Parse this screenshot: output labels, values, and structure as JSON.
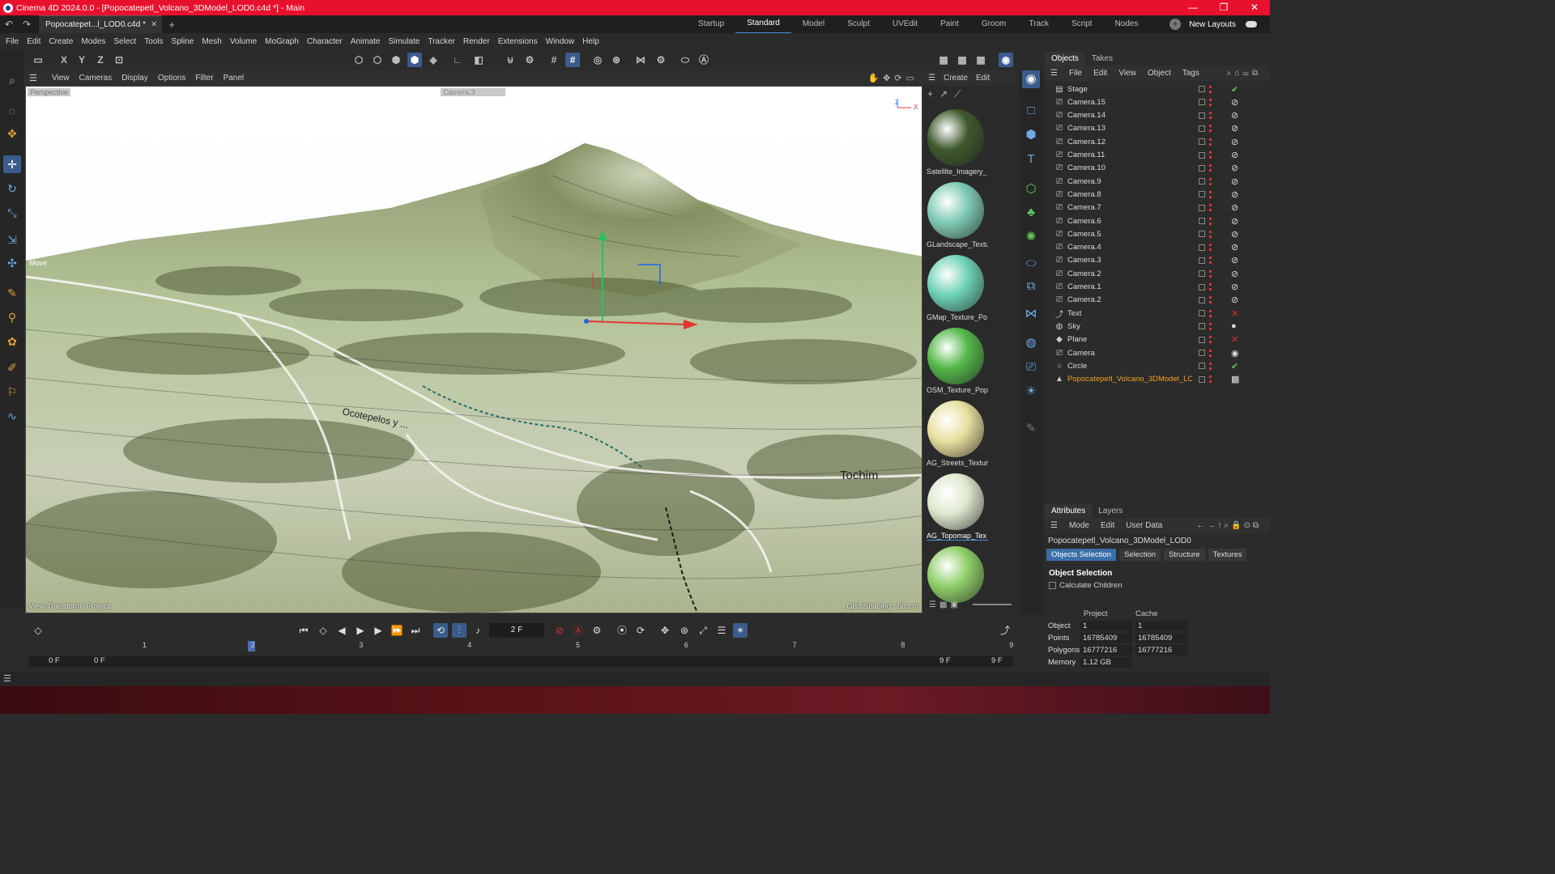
{
  "window": {
    "title": "Cinema 4D 2024.0.0 - [Popocatepetl_Volcano_3DModel_LOD0.c4d *] - Main"
  },
  "tabs": {
    "document": "Popocatepet...l_LOD0.c4d *"
  },
  "layouts": {
    "items": [
      "Startup",
      "Standard",
      "Model",
      "Sculpt",
      "UVEdit",
      "Paint",
      "Groom",
      "Track",
      "Script",
      "Nodes"
    ],
    "active": "Standard",
    "new_layouts": "New Layouts"
  },
  "menu": [
    "File",
    "Edit",
    "Create",
    "Modes",
    "Select",
    "Tools",
    "Spline",
    "Mesh",
    "Volume",
    "MoGraph",
    "Character",
    "Animate",
    "Simulate",
    "Tracker",
    "Render",
    "Extensions",
    "Window",
    "Help"
  ],
  "axis_toggles": [
    "X",
    "Y",
    "Z"
  ],
  "viewport": {
    "menu": [
      "View",
      "Cameras",
      "Display",
      "Options",
      "Filter",
      "Panel"
    ],
    "mode": "Perspective",
    "camera": "Camera.3",
    "move_label": "Move",
    "view_transform": "View Transform: Project",
    "grid_spacing": "Grid Spacing : 50 cm",
    "map_label": "Tochim",
    "map_label2": "Ocotepelos y ...",
    "axis_z": "Z",
    "axis_x": "X"
  },
  "materials": {
    "menu": [
      "Create",
      "Edit"
    ],
    "items": [
      {
        "name": "Satellite_Imagery_",
        "color": "#3f5a2e"
      },
      {
        "name": "GLandscape_Textu",
        "color": "#7fcbb5"
      },
      {
        "name": "GMap_Texture_Po",
        "color": "#6fd3b6"
      },
      {
        "name": "OSM_Texture_Pop",
        "color": "#55b84a"
      },
      {
        "name": "AG_Streets_Textur",
        "color": "#e8e0a0"
      },
      {
        "name": "AG_Topomap_Tex",
        "color": "#dfe8cf"
      },
      {
        "name": "",
        "color": "#8fcf6a"
      }
    ],
    "selected": 5
  },
  "objects": {
    "tabs": [
      "Objects",
      "Takes"
    ],
    "menu": [
      "File",
      "Edit",
      "View",
      "Object",
      "Tags"
    ],
    "rows": [
      {
        "name": "Stage",
        "tag": "✔",
        "tagc": "g"
      },
      {
        "name": "Camera.15",
        "tag": "⊘",
        "tagc": "w"
      },
      {
        "name": "Camera.14",
        "tag": "⊘",
        "tagc": "w"
      },
      {
        "name": "Camera.13",
        "tag": "⊘",
        "tagc": "w"
      },
      {
        "name": "Camera.12",
        "tag": "⊘",
        "tagc": "w"
      },
      {
        "name": "Camera.11",
        "tag": "⊘",
        "tagc": "w"
      },
      {
        "name": "Camera.10",
        "tag": "⊘",
        "tagc": "w"
      },
      {
        "name": "Camera.9",
        "tag": "⊘",
        "tagc": "w"
      },
      {
        "name": "Camera.8",
        "tag": "⊘",
        "tagc": "w"
      },
      {
        "name": "Camera.7",
        "tag": "⊘",
        "tagc": "w"
      },
      {
        "name": "Camera.6",
        "tag": "⊘",
        "tagc": "w"
      },
      {
        "name": "Camera.5",
        "tag": "⊘",
        "tagc": "w"
      },
      {
        "name": "Camera.4",
        "tag": "⊘",
        "tagc": "w"
      },
      {
        "name": "Camera.3",
        "tag": "⊘",
        "tagc": "w"
      },
      {
        "name": "Camera.2",
        "tag": "⊘",
        "tagc": "w"
      },
      {
        "name": "Camera.1",
        "tag": "⊘",
        "tagc": "w"
      },
      {
        "name": "Camera.2",
        "tag": "⊘",
        "tagc": "w"
      },
      {
        "name": "Text",
        "tag": "✕",
        "tagc": "r"
      },
      {
        "name": "Sky",
        "tag": "●",
        "tagc": "w"
      },
      {
        "name": "Plane",
        "tag": "✕",
        "tagc": "r"
      },
      {
        "name": "Camera",
        "tag": "◉",
        "tagc": "w"
      },
      {
        "name": "Circle",
        "tag": "✔",
        "tagc": "g"
      },
      {
        "name": "Popocatepetl_Volcano_3DModel_LOD0",
        "tag": "▩",
        "tagc": "w"
      }
    ],
    "selected": 22
  },
  "attributes": {
    "tabs": [
      "Attributes",
      "Layers"
    ],
    "menu": [
      "Mode",
      "Edit",
      "User Data"
    ],
    "object_name": "Popocatepetl_Volcano_3DModel_LOD0",
    "subtabs": [
      "Objects Selection",
      "Selection",
      "Structure",
      "Textures"
    ],
    "section": "Object Selection",
    "calc_children": "Calculate Children",
    "col_project": "Project",
    "col_cache": "Cache",
    "stats": [
      {
        "label": "Object",
        "project": "1",
        "cache": "1"
      },
      {
        "label": "Points",
        "project": "16785409",
        "cache": "16785409"
      },
      {
        "label": "Polygons",
        "project": "16777216",
        "cache": "16777216"
      },
      {
        "label": "Memory",
        "project": "1.12 GB",
        "cache": ""
      }
    ]
  },
  "timeline": {
    "current_frame": "2 F",
    "start": "0 F",
    "range_start": "0 F",
    "range_end": "9 F",
    "end": "9 F",
    "ticks": [
      "0",
      "1",
      "2",
      "3",
      "4",
      "5",
      "6",
      "7",
      "8",
      "9"
    ],
    "playhead_frame": 2
  },
  "colors": {
    "titlebar": "#e8112d",
    "accent": "#3a6ea8",
    "selected_object": "#f0a020"
  }
}
